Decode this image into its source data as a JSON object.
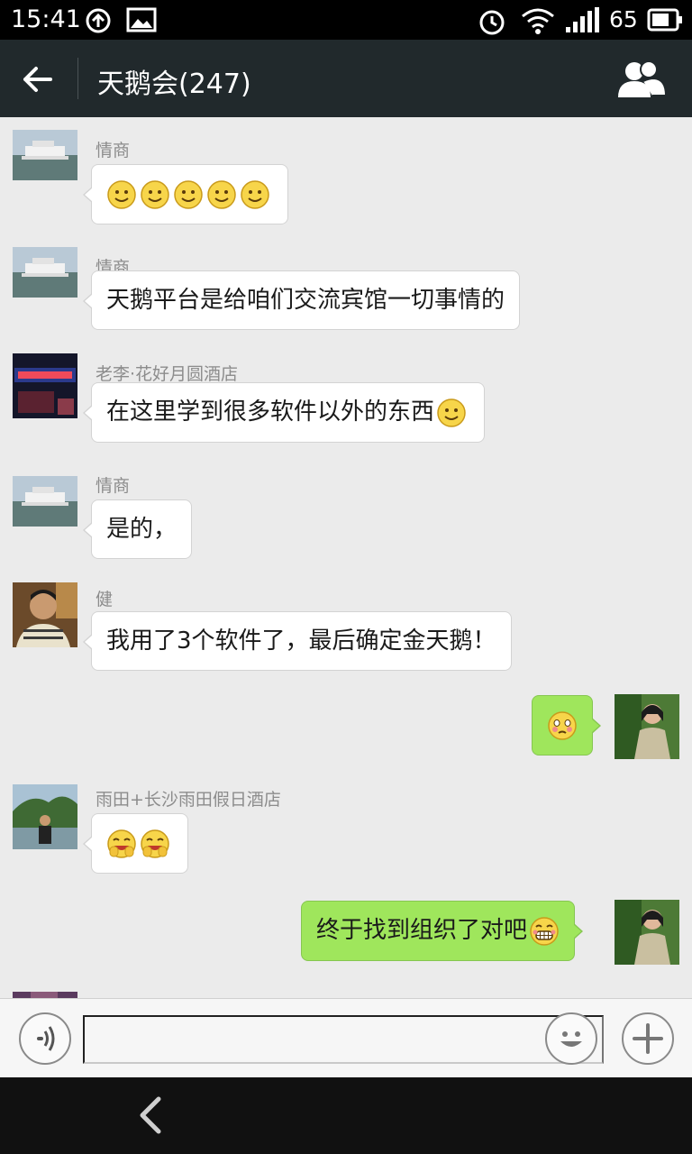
{
  "status_bar": {
    "time": "15:41",
    "battery_level": "65",
    "icons": [
      "sync-icon",
      "image-icon",
      "alarm-icon",
      "wifi-icon",
      "signal-icon",
      "battery-icon"
    ]
  },
  "header": {
    "title": "天鹅会(247)",
    "back_icon": "back-arrow-icon",
    "members_icon": "group-members-icon",
    "bg_color": "#21292c"
  },
  "messages": [
    {
      "direction": "in",
      "sender": "情商",
      "text": "",
      "emojis": [
        "smile",
        "smile",
        "smile",
        "smile",
        "smile"
      ],
      "avatar": "ferry-boat"
    },
    {
      "direction": "in",
      "sender": "情商",
      "text": "天鹅平台是给咱们交流宾馆一切事情的",
      "emojis": [],
      "avatar": "ferry-boat"
    },
    {
      "direction": "in",
      "sender": "老李·花好月圆酒店",
      "text": "在这里学到很多软件以外的东西",
      "emojis": [
        "smile"
      ],
      "avatar": "hotel-sign"
    },
    {
      "direction": "in",
      "sender": "情商",
      "text": "是的，",
      "emojis": [],
      "avatar": "ferry-boat"
    },
    {
      "direction": "in",
      "sender": "健",
      "text": "我用了3个软件了，最后确定金天鹅！",
      "emojis": [],
      "avatar": "man-portrait"
    },
    {
      "direction": "out",
      "sender": "",
      "text": "",
      "emojis": [
        "blush-sweat"
      ],
      "avatar": "woman-garden"
    },
    {
      "direction": "in",
      "sender": "雨田+长沙雨田假日酒店",
      "text": "",
      "emojis": [
        "chuckle",
        "chuckle"
      ],
      "avatar": "man-by-lake"
    },
    {
      "direction": "out",
      "sender": "",
      "text": "终于找到组织了对吧",
      "emojis": [
        "grin"
      ],
      "avatar": "woman-garden"
    }
  ],
  "input_bar": {
    "voice_icon": "voice-input-icon",
    "emoji_icon": "emoji-icon",
    "plus_icon": "plus-icon",
    "message_value": ""
  },
  "nav_bar": {
    "back_icon": "nav-back-icon"
  },
  "colors": {
    "chat_bg": "#ebebeb",
    "incoming_bubble": "#ffffff",
    "outgoing_bubble": "#9fe65c"
  }
}
